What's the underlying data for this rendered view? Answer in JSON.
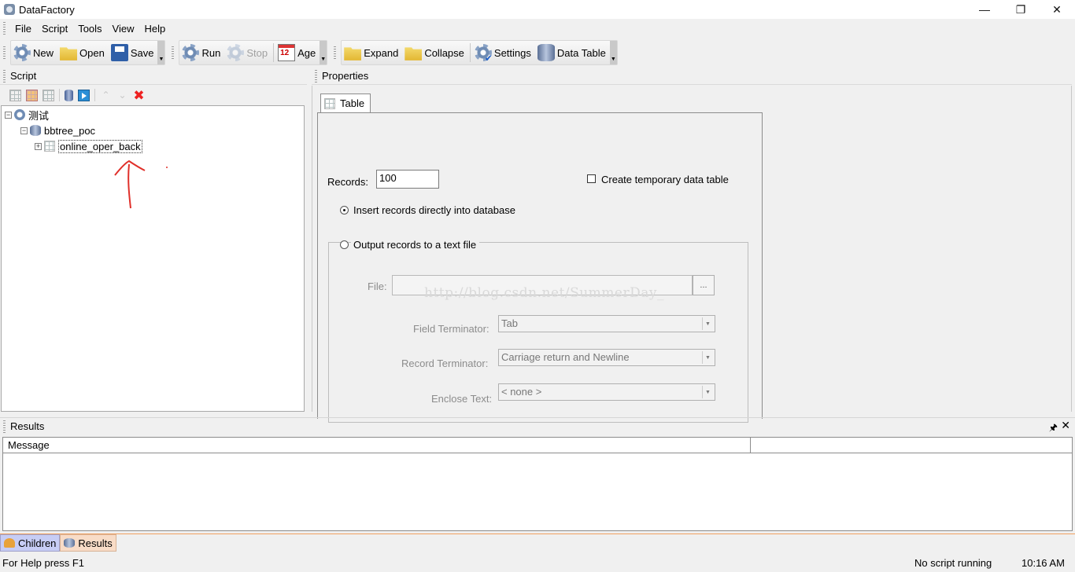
{
  "window": {
    "title": "DataFactory",
    "minimize": "—",
    "restore": "❐",
    "close": "✕"
  },
  "menu": [
    "File",
    "Script",
    "Tools",
    "View",
    "Help"
  ],
  "toolbar": {
    "new": "New",
    "open": "Open",
    "save": "Save",
    "run": "Run",
    "stop": "Stop",
    "age": "Age",
    "expand": "Expand",
    "collapse": "Collapse",
    "settings": "Settings",
    "data_table": "Data Table"
  },
  "script_panel": {
    "title": "Script",
    "tree": {
      "root": "测试",
      "database": "bbtree_poc",
      "table": "online_oper_back"
    }
  },
  "properties_panel": {
    "title": "Properties",
    "tab": "Table",
    "records_label": "Records:",
    "records_value": "100",
    "temp_table_label": "Create temporary data table",
    "temp_table_checked": false,
    "insert_label": "Insert records directly into database",
    "output_label": "Output records to a text file",
    "file_label": "File:",
    "file_value": "",
    "browse_label": "...",
    "field_terminator_label": "Field Terminator:",
    "field_terminator_value": "Tab",
    "record_terminator_label": "Record Terminator:",
    "record_terminator_value": "Carriage return and Newline",
    "enclose_text_label": "Enclose Text:",
    "enclose_text_value": "< none >",
    "watermark": "http://blog.csdn.net/SummerDay_"
  },
  "results_panel": {
    "title": "Results",
    "pin": "🖈",
    "close": "✕",
    "columns": [
      "Message",
      ""
    ]
  },
  "bottom_tabs": {
    "children": "Children",
    "results": "Results"
  },
  "status": {
    "help": "For Help press F1",
    "running": "No script running",
    "time": "10:16 AM"
  },
  "colors": {
    "annotation": "#e0302a",
    "children_tab": "#c7cdf5",
    "results_tab": "#f8dcc7"
  }
}
